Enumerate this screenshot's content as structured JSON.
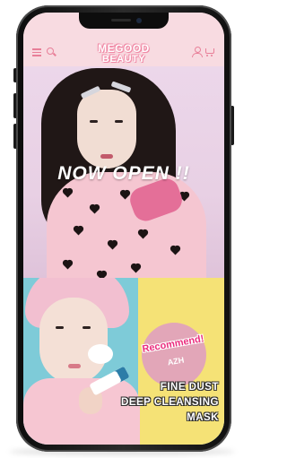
{
  "header": {
    "logo_line1": "MEGOOD",
    "logo_line2": "BEAUTY"
  },
  "hero": {
    "headline": "NOW OPEN !!"
  },
  "banner": {
    "badge_text": "Recommend!",
    "brand": "AZH",
    "product_lines": [
      "FINE DUST",
      "DEEP CLEANSING",
      "MASK"
    ]
  },
  "colors": {
    "brand_pink": "#f08aa6",
    "header_bg": "#f8dbe1",
    "banner_teal": "#7ecbd8",
    "banner_yellow": "#f5e276",
    "badge_magenta": "#ea2f7f"
  },
  "icons": [
    "menu-icon",
    "search-icon",
    "account-icon",
    "cart-icon"
  ]
}
